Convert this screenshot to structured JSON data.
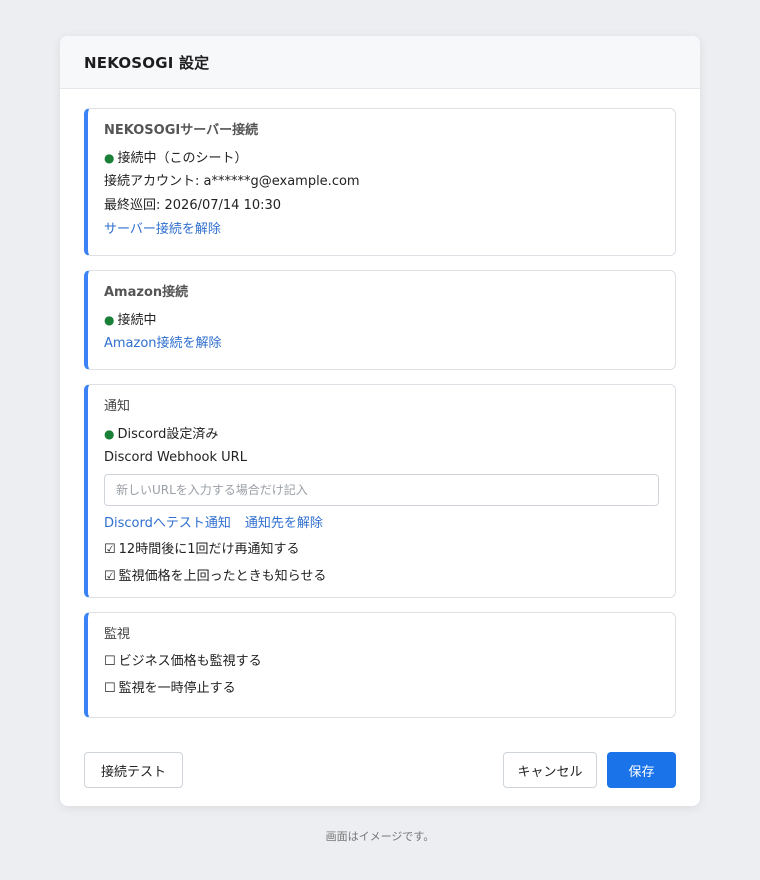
{
  "dialog": {
    "title": "NEKOSOGI 設定"
  },
  "server": {
    "title": "NEKOSOGIサーバー接続",
    "status": "接続中（このシート）",
    "account": "接続アカウント: a******g@example.com",
    "last_patrol": "最終巡回: 2026/07/14 10:30",
    "disconnect_link": "サーバー接続を解除"
  },
  "amazon": {
    "title": "Amazon接続",
    "status": "接続中",
    "disconnect_link": "Amazon接続を解除"
  },
  "notification": {
    "title": "通知",
    "status": "Discord設定済み",
    "webhook_label": "Discord Webhook URL",
    "webhook_value": "",
    "webhook_placeholder": "新しいURLを入力する場合だけ記入",
    "test_link": "Discordへテスト通知",
    "remove_link": "通知先を解除",
    "options": [
      {
        "label": "12時間後に1回だけ再通知する",
        "checked": true
      },
      {
        "label": "監視価格を上回ったときも知らせる",
        "checked": true
      }
    ]
  },
  "monitoring": {
    "title": "監視",
    "options": [
      {
        "label": "ビジネス価格も監視する",
        "checked": false
      },
      {
        "label": "監視を一時停止する",
        "checked": false
      }
    ]
  },
  "footer": {
    "test_button": "接続テスト",
    "cancel_button": "キャンセル",
    "save_button": "保存"
  },
  "caption": "画面はイメージです。",
  "colors": {
    "accent": "#3b82f6",
    "primary_button": "#1a73e8",
    "link": "#2f6fcf",
    "status_dot": "#1a7f37",
    "background": "#eceef1"
  },
  "icons": {
    "status": "green-dot",
    "checked": "checked-box",
    "unchecked": "empty-box"
  }
}
